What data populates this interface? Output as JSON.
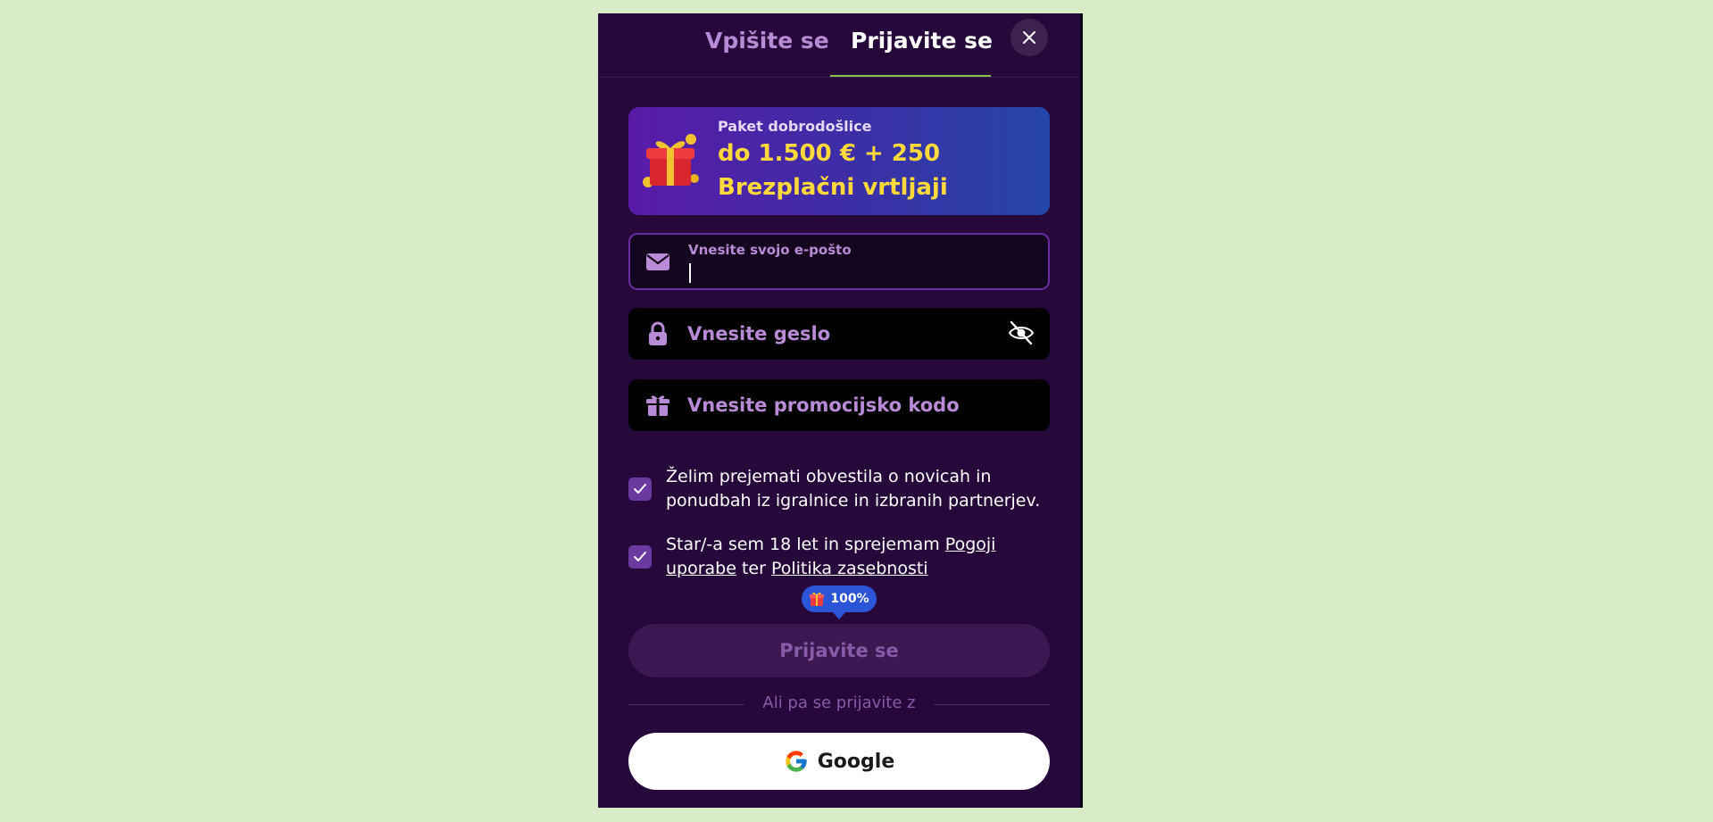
{
  "tabs": {
    "signup": "Vpišite se",
    "login": "Prijavite se",
    "active": "login"
  },
  "close_icon": "close-icon",
  "banner": {
    "label": "Paket dobrodošlice",
    "amount": "do 1.500 € + 250",
    "spins": "Brezplačni vrtljaji",
    "icon": "gift-icon"
  },
  "form": {
    "email": {
      "label": "Vnesite svojo e-pošto",
      "value": "",
      "icon": "envelope-icon"
    },
    "password": {
      "placeholder": "Vnesite geslo",
      "value": "",
      "icon": "lock-icon",
      "toggle_icon": "eye-off-icon"
    },
    "promo": {
      "placeholder": "Vnesite promocijsko kodo",
      "value": "",
      "icon": "gift-icon"
    }
  },
  "checkboxes": {
    "news": {
      "checked": true,
      "text": "Želim prejemati obvestila o novicah in ponudbah iz igralnice in izbranih partnerjev."
    },
    "terms": {
      "checked": true,
      "text_before": "Star/-a sem 18 let in sprejemam ",
      "link_terms": "Pogoji uporabe",
      "text_middle": " ter ",
      "link_privacy": "Politika zasebnosti"
    }
  },
  "bonus_badge": {
    "text": "100%",
    "icon": "gift-icon"
  },
  "submit_label": "Prijavite se",
  "divider_text": "Ali pa se prijavite z",
  "google_label": "Google",
  "colors": {
    "modal_bg": "#26093a",
    "accent_purple": "#b98ad6",
    "promo_yellow": "#ffd93b",
    "tab_underline": "#8bc34a",
    "badge_blue": "#2b55d6"
  }
}
